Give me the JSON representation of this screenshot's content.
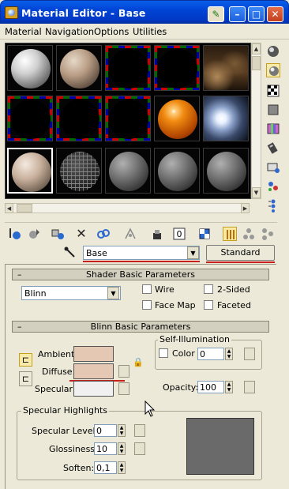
{
  "window": {
    "title": "Material Editor - Base"
  },
  "menu": [
    "Material",
    "Navigation",
    "Options",
    "Utilities"
  ],
  "material": {
    "name": "Base",
    "type": "Standard"
  },
  "shader_basic": {
    "header": "Shader Basic Parameters",
    "shader": "Blinn",
    "options": [
      {
        "label": "Wire",
        "checked": false
      },
      {
        "label": "2-Sided",
        "checked": false
      },
      {
        "label": "Face Map",
        "checked": false
      },
      {
        "label": "Faceted",
        "checked": false
      }
    ]
  },
  "blinn_basic": {
    "header": "Blinn Basic Parameters",
    "ambient_label": "Ambient:",
    "diffuse_label": "Diffuse:",
    "specular_label": "Specular:",
    "ambient_color": "#e4c8b4",
    "diffuse_color": "#e4c8b4",
    "specular_color": "#f0f0f0",
    "self_illum_title": "Self-Illumination",
    "color_label": "Color",
    "color_value": "0",
    "opacity_label": "Opacity:",
    "opacity_value": "100"
  },
  "specular_highlights": {
    "title": "Specular Highlights",
    "level_label": "Specular Level:",
    "level_value": "0",
    "gloss_label": "Glossiness:",
    "gloss_value": "10",
    "soften_label": "Soften:",
    "soften_value": "0,1"
  },
  "toolbar_icons": [
    "get-material-icon",
    "put-to-scene-icon",
    "assign-to-selection-icon",
    "reset-map-icon",
    "make-copy-icon",
    "make-unique-icon",
    "put-to-library-icon",
    "material-id-icon",
    "show-map-icon",
    "show-end-result-icon",
    "go-to-parent-icon",
    "go-forward-icon"
  ],
  "side_icons": [
    "sample-type-icon",
    "backlight-icon",
    "background-icon",
    "uv-tiling-icon",
    "video-check-icon",
    "make-preview-icon",
    "options-icon",
    "select-by-material-icon",
    "material-navigator-icon"
  ]
}
